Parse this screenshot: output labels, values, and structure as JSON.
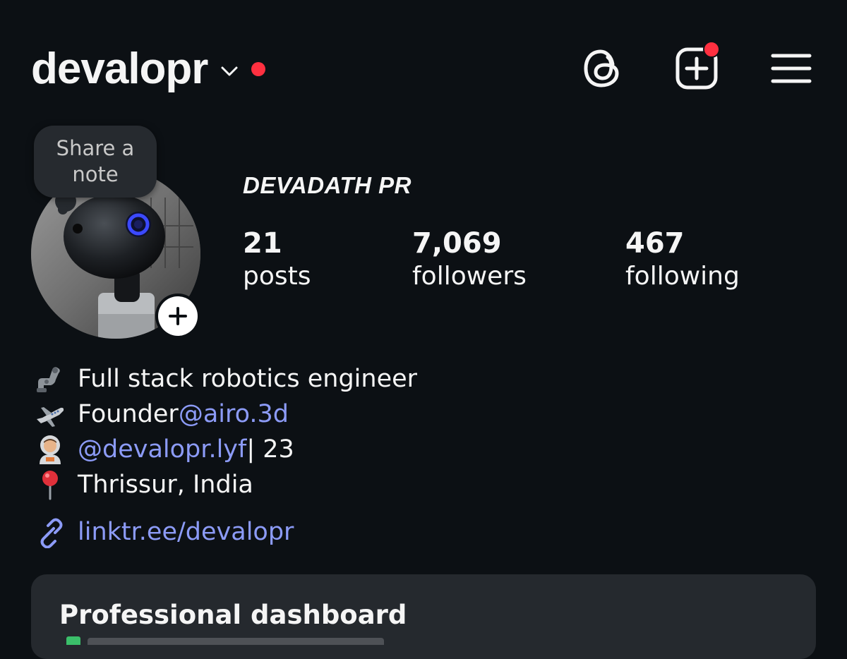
{
  "header": {
    "username": "devalopr"
  },
  "profile": {
    "note_placeholder": "Share a note",
    "display_name": "DEVADATH PR",
    "stats": [
      {
        "value": "21",
        "label": "posts"
      },
      {
        "value": "7,069",
        "label": "followers"
      },
      {
        "value": "467",
        "label": "following"
      }
    ]
  },
  "bio": {
    "line1": {
      "text": "Full stack robotics engineer",
      "emoji": "mechanical-arm"
    },
    "line2": {
      "prefix": "Founder ",
      "mention": "@airo.3d",
      "emoji": "airplane"
    },
    "line3": {
      "mention": "@devalopr.lyf",
      "suffix": " | 23",
      "emoji": "astronaut"
    },
    "line4": {
      "text": "Thrissur, India",
      "emoji": "round-pushpin"
    },
    "link": "linktr.ee/devalopr"
  },
  "dashboard": {
    "title": "Professional dashboard"
  },
  "colors": {
    "background": "#0c1014",
    "text": "#f5f5f5",
    "link": "#8c9bf7",
    "notification": "#ff3040",
    "card": "#25292e"
  },
  "icons": [
    "chevron-down-icon",
    "threads-icon",
    "create-icon",
    "menu-icon",
    "plus-icon",
    "link-icon"
  ]
}
